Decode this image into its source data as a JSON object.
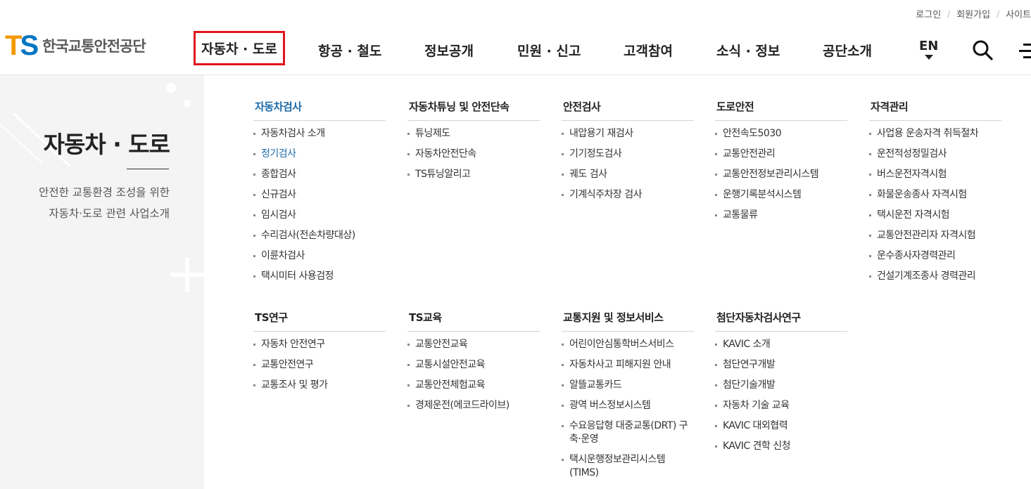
{
  "util": {
    "login": "로그인",
    "join": "회원가입",
    "sitemap": "사이트",
    "sep": "/"
  },
  "logo": {
    "mark_t": "T",
    "mark_s": "S",
    "name": "한국교통안전공단"
  },
  "gnb": [
    {
      "label": "자동차 · 도로",
      "active": true
    },
    {
      "label": "항공 · 철도"
    },
    {
      "label": "정보공개"
    },
    {
      "label": "민원 · 신고"
    },
    {
      "label": "고객참여"
    },
    {
      "label": "소식 · 정보"
    },
    {
      "label": "공단소개"
    }
  ],
  "lang": "EN",
  "icons": {
    "search": "search-icon",
    "menu": "menu-icon",
    "lang_caret": "caret-down-icon"
  },
  "side": {
    "title": "자동차 · 도로",
    "desc_line1": "안전한 교통환경 조성을 위한",
    "desc_line2": "자동차·도로 관련 사업소개"
  },
  "columns": [
    {
      "title": "자동차검사",
      "items": [
        "자동차검사 소개",
        "정기검사",
        "종합검사",
        "신규검사",
        "임시검사",
        "수리검사(전손차량대상)",
        "이륜차검사",
        "택시미터 사용검정"
      ]
    },
    {
      "title": "자동차튜닝 및 안전단속",
      "items": [
        "튜닝제도",
        "자동차안전단속",
        "TS튜닝알리고"
      ]
    },
    {
      "title": "안전검사",
      "items": [
        "내압용기 재검사",
        "기기정도검사",
        "궤도 검사",
        "기계식주차장 검사"
      ]
    },
    {
      "title": "도로안전",
      "items": [
        "안전속도5030",
        "교통안전관리",
        "교통안전정보관리시스템",
        "운행기록분석시스템",
        "교통물류"
      ]
    },
    {
      "title": "자격관리",
      "items": [
        "사업용 운송자격 취득절차",
        "운전적성정밀검사",
        "버스운전자격시험",
        "화물운송종사 자격시험",
        "택시운전 자격시험",
        "교통안전관리자 자격시험",
        "운수종사자경력관리",
        "건설기계조종사 경력관리"
      ]
    },
    {
      "title": "TS연구",
      "items": [
        "자동차 안전연구",
        "교통안전연구",
        "교통조사 및 평가"
      ]
    },
    {
      "title": "TS교육",
      "items": [
        "교통안전교육",
        "교통시설안전교육",
        "교통안전체험교육",
        "경제운전(에코드라이브)"
      ]
    },
    {
      "title": "교통지원 및 정보서비스",
      "items": [
        "어린이안심통학버스서비스",
        "자동차사고 피해지원 안내",
        "알뜰교통카드",
        "광역 버스정보시스템",
        "수요응답형 대중교통(DRT) 구축·운영",
        "택시운행정보관리시스템 (TIMS)"
      ]
    },
    {
      "title": "첨단자동차검사연구",
      "items": [
        "KAVIC 소개",
        "첨단연구개발",
        "첨단기술개발",
        "자동차 기술 교육",
        "KAVIC 대외협력",
        "KAVIC 견학 신청"
      ]
    }
  ],
  "colors": {
    "active_border": "#e0141e",
    "link_blue": "#1d6aa8",
    "logo_orange": "#f39800",
    "logo_blue": "#0075c1",
    "side_bg": "#f4f4f5"
  }
}
